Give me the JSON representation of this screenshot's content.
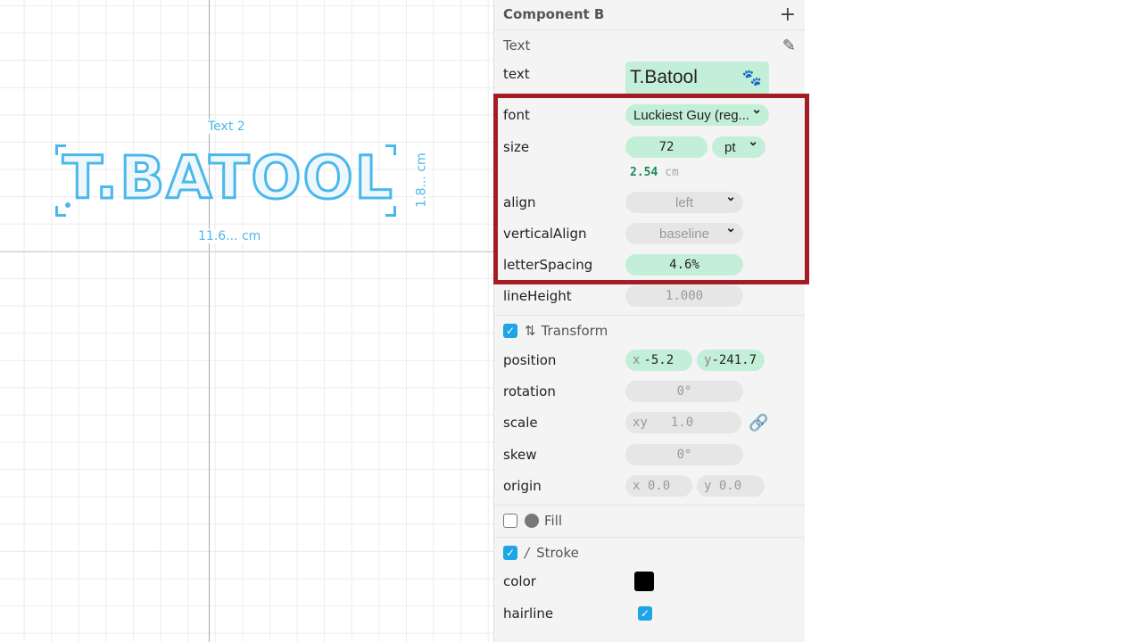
{
  "canvas": {
    "object_label": "Text 2",
    "text": "T.BATOOL",
    "width_label": "11.6... cm",
    "height_label": "1.8... cm"
  },
  "panel": {
    "title": "Component B",
    "add_icon": "plus-icon",
    "text_section": {
      "title": "Text",
      "edit_icon": "pencil-icon",
      "text": {
        "label": "text",
        "value": "T.Batool",
        "icon": "paw-icon"
      },
      "font": {
        "label": "font",
        "value": "Luckiest Guy (reg..."
      },
      "size": {
        "label": "size",
        "value": "72",
        "unit": "pt",
        "converted": "2.54",
        "converted_unit": "cm"
      },
      "align": {
        "label": "align",
        "value": "left"
      },
      "verticalAlign": {
        "label": "verticalAlign",
        "value": "baseline"
      },
      "letterSpacing": {
        "label": "letterSpacing",
        "value": "4.6%"
      },
      "lineHeight": {
        "label": "lineHeight",
        "value": "1.000"
      }
    },
    "transform": {
      "title": "Transform",
      "checked": true,
      "position": {
        "label": "position",
        "x_prefix": "x",
        "x": "-5.2",
        "y_prefix": "y",
        "y": "-241.7"
      },
      "rotation": {
        "label": "rotation",
        "value": "0°"
      },
      "scale": {
        "label": "scale",
        "prefix": "xy",
        "value": "1.0",
        "icon": "link-icon"
      },
      "skew": {
        "label": "skew",
        "value": "0°"
      },
      "origin": {
        "label": "origin",
        "x": "x 0.0",
        "y": "y 0.0"
      }
    },
    "fill": {
      "title": "Fill",
      "checked": false
    },
    "stroke": {
      "title": "Stroke",
      "checked": true,
      "color": {
        "label": "color",
        "value": "#000000"
      },
      "hairline": {
        "label": "hairline",
        "checked": true
      }
    }
  },
  "colors": {
    "accent": "#4ab8ea",
    "highlight": "#a51c24",
    "field_active": "#c3efd8"
  }
}
